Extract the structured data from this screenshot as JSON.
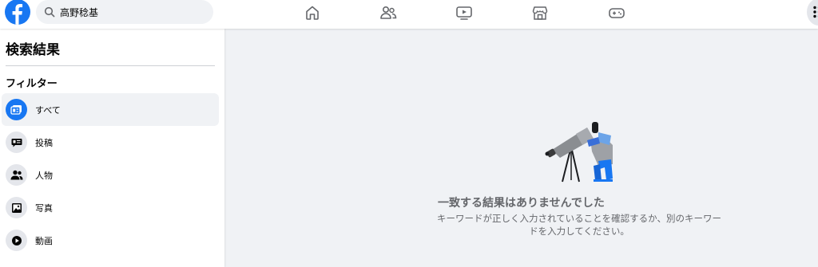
{
  "search": {
    "value": "高野稔基"
  },
  "header": {
    "nav": [
      {
        "name": "home",
        "icon": "home-icon"
      },
      {
        "name": "friends",
        "icon": "friends-icon"
      },
      {
        "name": "video",
        "icon": "video-icon"
      },
      {
        "name": "marketplace",
        "icon": "marketplace-icon"
      },
      {
        "name": "gaming",
        "icon": "gaming-icon"
      }
    ],
    "menu_icon": "menu-dots-icon"
  },
  "sidebar": {
    "title": "検索結果",
    "filter_heading": "フィルター",
    "items": [
      {
        "label": "すべて",
        "icon": "all-results-icon",
        "active": true
      },
      {
        "label": "投稿",
        "icon": "posts-icon"
      },
      {
        "label": "人物",
        "icon": "people-icon"
      },
      {
        "label": "写真",
        "icon": "photos-icon"
      },
      {
        "label": "動画",
        "icon": "videos-icon"
      }
    ]
  },
  "empty_state": {
    "title": "一致する結果はありませんでした",
    "description": "キーワードが正しく入力されていることを確認するか、別のキーワードを入力してください。",
    "illustration": "telescope-person-illustration"
  },
  "colors": {
    "brand": "#1877f2",
    "background": "#f0f2f5",
    "secondary_text": "#65676b"
  }
}
